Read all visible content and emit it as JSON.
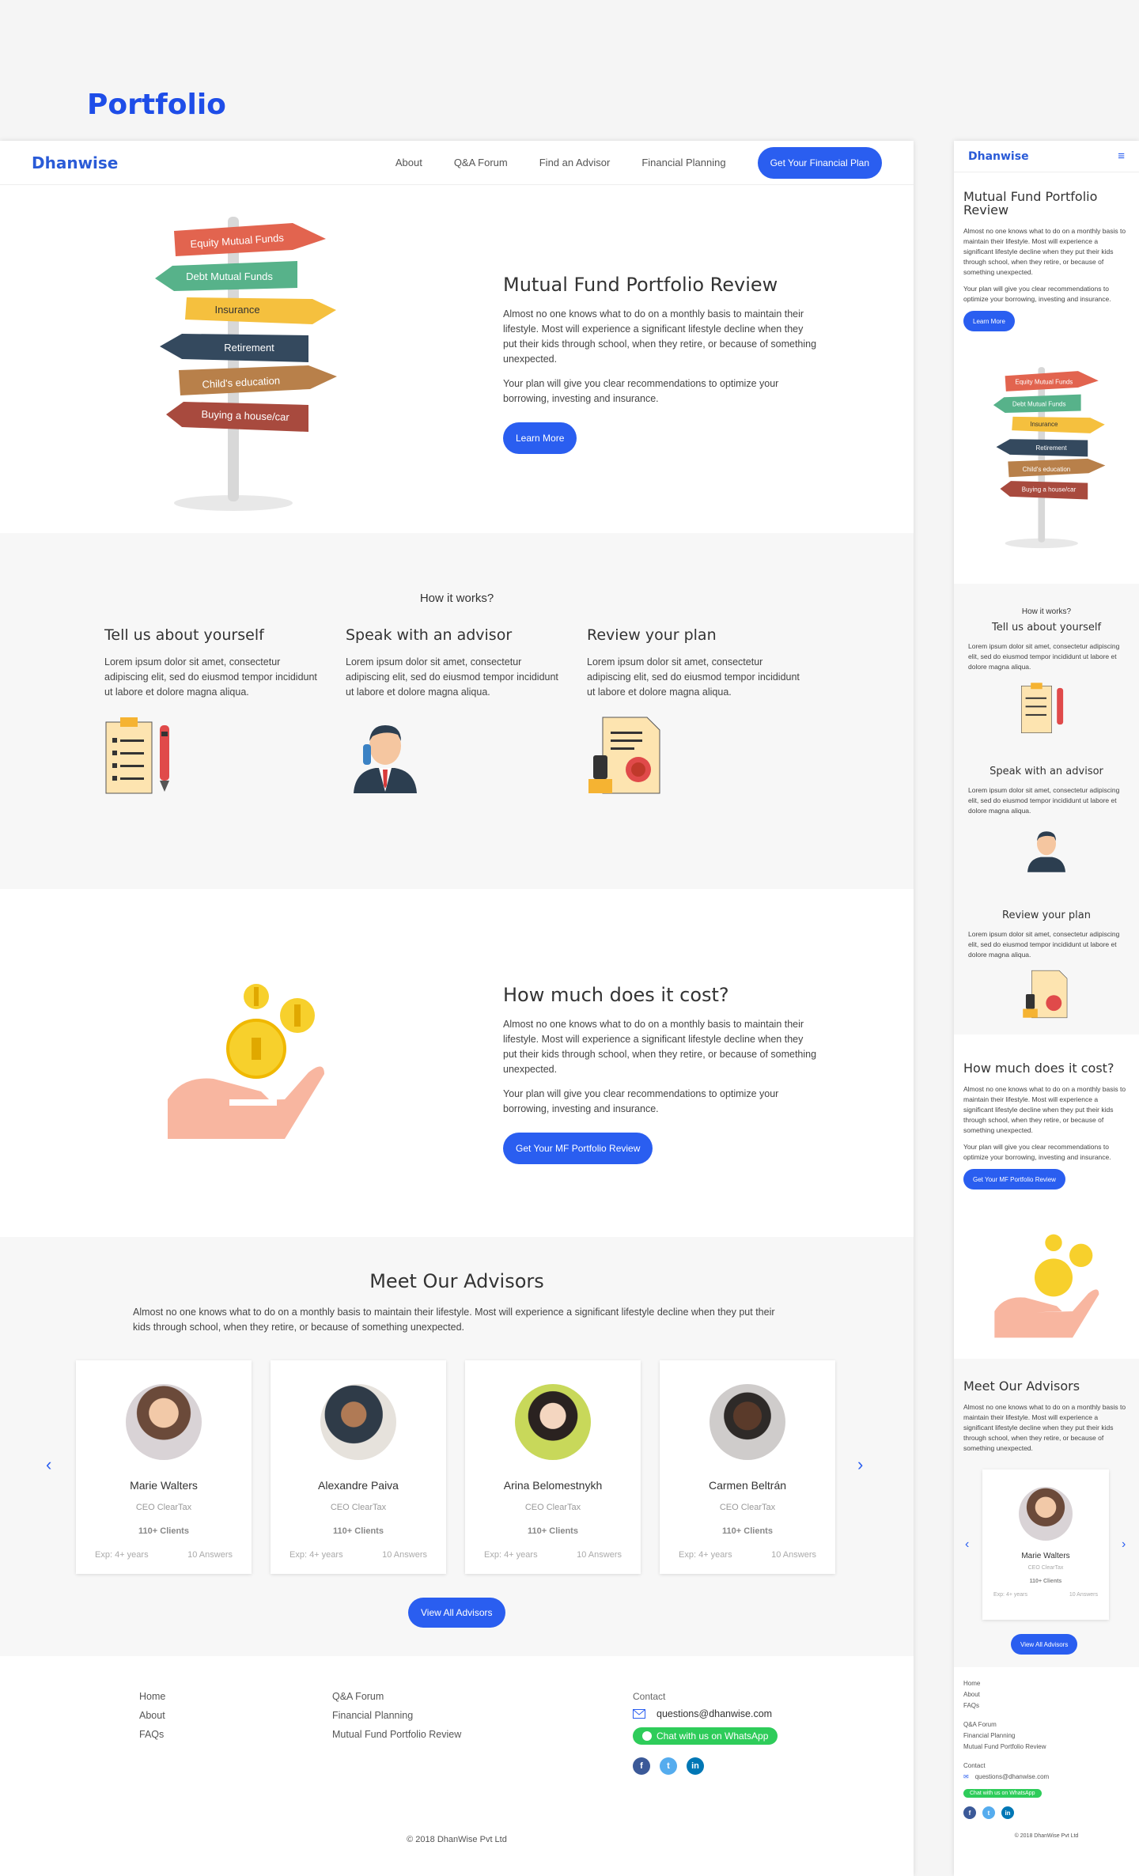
{
  "page_title": "Portfolio",
  "brand": "Dhanwise",
  "nav": {
    "items": [
      "About",
      "Q&A Forum",
      "Find an Advisor",
      "Financial Planning"
    ],
    "cta": "Get Your Financial Plan"
  },
  "signpost": [
    "Equity Mutual Funds",
    "Debt Mutual Funds",
    "Insurance",
    "Retirement",
    "Child's education",
    "Buying a house/car"
  ],
  "hero": {
    "title": "Mutual Fund Portfolio Review",
    "p1": "Almost no one knows what to do on a monthly basis to maintain their lifestyle. Most will experience a significant lifestyle decline when they put their kids through school, when they retire, or because of something unexpected.",
    "p2": "Your plan will give you clear recommendations to optimize your borrowing, investing and insurance.",
    "button": "Learn More"
  },
  "how": {
    "title": "How it works?",
    "steps": [
      {
        "title": "Tell us about yourself",
        "text": "Lorem ipsum dolor sit amet, consectetur adipiscing elit, sed do eiusmod tempor incididunt ut labore et dolore magna aliqua.",
        "icon": "clipboard-icon"
      },
      {
        "title": "Speak with an advisor",
        "text": "Lorem ipsum dolor sit amet, consectetur adipiscing elit, sed do eiusmod tempor incididunt ut labore et dolore magna aliqua.",
        "icon": "advisor-phone-icon"
      },
      {
        "title": "Review your plan",
        "text": "Lorem ipsum dolor sit amet, consectetur adipiscing elit, sed do eiusmod tempor incididunt ut labore et dolore magna aliqua.",
        "icon": "document-stamp-icon"
      }
    ]
  },
  "cost": {
    "title": "How much does it cost?",
    "p1": "Almost no one knows what to do on a monthly basis to maintain their lifestyle. Most will experience a significant lifestyle decline when they put their kids through school, when they retire, or because of something unexpected.",
    "p2": "Your plan will give you clear recommendations to optimize your borrowing, investing and insurance.",
    "button": "Get Your MF Portfolio Review"
  },
  "advisors": {
    "title": "Meet Our Advisors",
    "desc": "Almost no one knows what to do on a monthly basis to maintain their lifestyle. Most will experience a significant lifestyle decline when they put their kids through school, when they retire, or because of something unexpected.",
    "list": [
      {
        "name": "Marie Walters",
        "role": "CEO ClearTax",
        "clients": "110+ Clients",
        "exp": "Exp: 4+ years",
        "answers": "10 Answers"
      },
      {
        "name": "Alexandre Paiva",
        "role": "CEO ClearTax",
        "clients": "110+ Clients",
        "exp": "Exp: 4+ years",
        "answers": "10 Answers"
      },
      {
        "name": "Arina Belomestnykh",
        "role": "CEO ClearTax",
        "clients": "110+ Clients",
        "exp": "Exp: 4+ years",
        "answers": "10 Answers"
      },
      {
        "name": "Carmen Beltrán",
        "role": "CEO ClearTax",
        "clients": "110+ Clients",
        "exp": "Exp: 4+ years",
        "answers": "10 Answers"
      }
    ],
    "button": "View All Advisors"
  },
  "footer": {
    "col1": [
      "Home",
      "About",
      "FAQs"
    ],
    "col2": [
      "Q&A Forum",
      "Financial Planning",
      "Mutual Fund Portfolio Review"
    ],
    "contact_label": "Contact",
    "email": "questions@dhanwise.com",
    "whatsapp": "Chat with us on WhatsApp",
    "socials": [
      "facebook-icon",
      "twitter-icon",
      "linkedin-icon"
    ],
    "copyright": "© 2018 DhanWise Pvt Ltd"
  },
  "colors": {
    "accent": "#2a5ef0",
    "brand": "#2a5bd7",
    "whatsapp": "#2ecc5a"
  }
}
